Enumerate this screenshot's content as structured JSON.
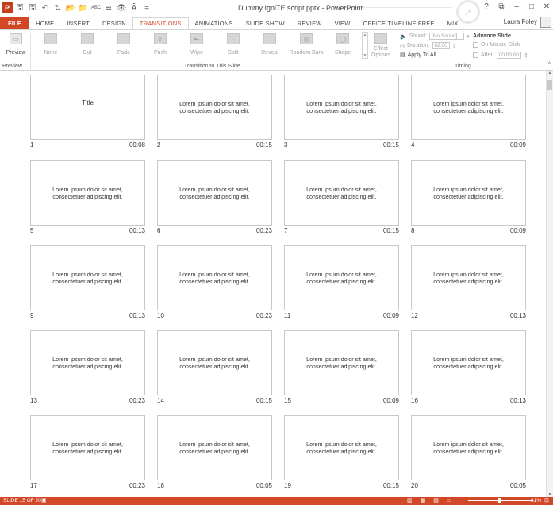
{
  "window": {
    "title": "Dummy IgniTE script.pptx - PowerPoint",
    "user": "Laura Foley",
    "controls": [
      "?",
      "⧉",
      "–",
      "□",
      "✕"
    ]
  },
  "qat": [
    "P",
    "🖫",
    "🖫",
    "↶",
    "↻",
    "📂",
    "📁",
    "ABC",
    "≋",
    "👁",
    "Â",
    "="
  ],
  "tabs": [
    {
      "label": "FILE",
      "kind": "file"
    },
    {
      "label": "HOME"
    },
    {
      "label": "INSERT"
    },
    {
      "label": "DESIGN"
    },
    {
      "label": "TRANSITIONS",
      "kind": "active"
    },
    {
      "label": "ANIMATIONS"
    },
    {
      "label": "SLIDE SHOW"
    },
    {
      "label": "REVIEW"
    },
    {
      "label": "VIEW"
    },
    {
      "label": "OFFICE TIMELINE FREE"
    },
    {
      "label": "MIX"
    }
  ],
  "ribbon": {
    "preview_label": "Preview",
    "preview_group": "Preview",
    "transitions": [
      "None",
      "Cut",
      "Fade",
      "Push",
      "Wipe",
      "Split",
      "Reveal",
      "Random Bars",
      "Shape"
    ],
    "effect_options": "Effect Options",
    "transition_group": "Transition to This Slide",
    "sound_label": "Sound:",
    "sound_value": "[No Sound]",
    "duration_label": "Duration:",
    "duration_value": "02.00",
    "apply_all": "Apply To All",
    "advance_title": "Advance Slide",
    "on_mouse_click": "On Mouse Click",
    "after_label": "After:",
    "after_value": "00:00.00",
    "timing_group": "Timing"
  },
  "slides": [
    {
      "num": "1",
      "dur": "00:08",
      "text": "Title",
      "is_title": true
    },
    {
      "num": "2",
      "dur": "00:15",
      "text": "Lorem ipsum dolor sit amet,\nconsectetuer adipiscing elit."
    },
    {
      "num": "3",
      "dur": "00:15",
      "text": "Lorem ipsum dolor sit amet,\nconsectetuer adipiscing elit."
    },
    {
      "num": "4",
      "dur": "00:09",
      "text": "Lorem ipsum dolor sit amet,\nconsectetuer adipiscing elit."
    },
    {
      "num": "5",
      "dur": "00:13",
      "text": "Lorem ipsum dolor sit amet,\nconsectetuer adipiscing elit."
    },
    {
      "num": "6",
      "dur": "00:23",
      "text": "Lorem ipsum dolor sit amet,\nconsectetuer adipiscing elit."
    },
    {
      "num": "7",
      "dur": "00:15",
      "text": "Lorem ipsum dolor sit amet,\nconsectetuer adipiscing elit."
    },
    {
      "num": "8",
      "dur": "00:09",
      "text": "Lorem ipsum dolor sit amet,\nconsectetuer adipiscing elit."
    },
    {
      "num": "9",
      "dur": "00:13",
      "text": "Lorem ipsum dolor sit amet,\nconsectetuer adipiscing elit."
    },
    {
      "num": "10",
      "dur": "00:23",
      "text": "Lorem ipsum dolor sit amet,\nconsectetuer adipiscing elit."
    },
    {
      "num": "11",
      "dur": "00:09",
      "text": "Lorem ipsum dolor sit amet,\nconsectetuer adipiscing elit."
    },
    {
      "num": "12",
      "dur": "00:13",
      "text": "Lorem ipsum dolor sit amet,\nconsectetuer adipiscing elit."
    },
    {
      "num": "13",
      "dur": "00:23",
      "text": "Lorem ipsum dolor sit amet,\nconsectetuer adipiscing elit."
    },
    {
      "num": "14",
      "dur": "00:15",
      "text": "Lorem ipsum dolor sit amet,\nconsectetuer adipiscing elit."
    },
    {
      "num": "15",
      "dur": "00:09",
      "text": "Lorem ipsum dolor sit amet,\nconsectetuer adipiscing elit."
    },
    {
      "num": "16",
      "dur": "00:13",
      "text": "Lorem ipsum dolor sit amet,\nconsectetuer adipiscing elit."
    },
    {
      "num": "17",
      "dur": "00:23",
      "text": "Lorem ipsum dolor sit amet,\nconsectetuer adipiscing elit."
    },
    {
      "num": "18",
      "dur": "00:05",
      "text": "Lorem ipsum dolor sit amet,\nconsectetuer adipiscing elit."
    },
    {
      "num": "19",
      "dur": "00:15",
      "text": "Lorem ipsum dolor sit amet,\nconsectetuer adipiscing elit."
    },
    {
      "num": "20",
      "dur": "00:05",
      "text": "Lorem ipsum dolor sit amet,\nconsectetuer adipiscing elit."
    }
  ],
  "status": {
    "slide_info": "SLIDE 15 OF 20",
    "zoom": "81%"
  },
  "colors": {
    "accent": "#d24726"
  }
}
